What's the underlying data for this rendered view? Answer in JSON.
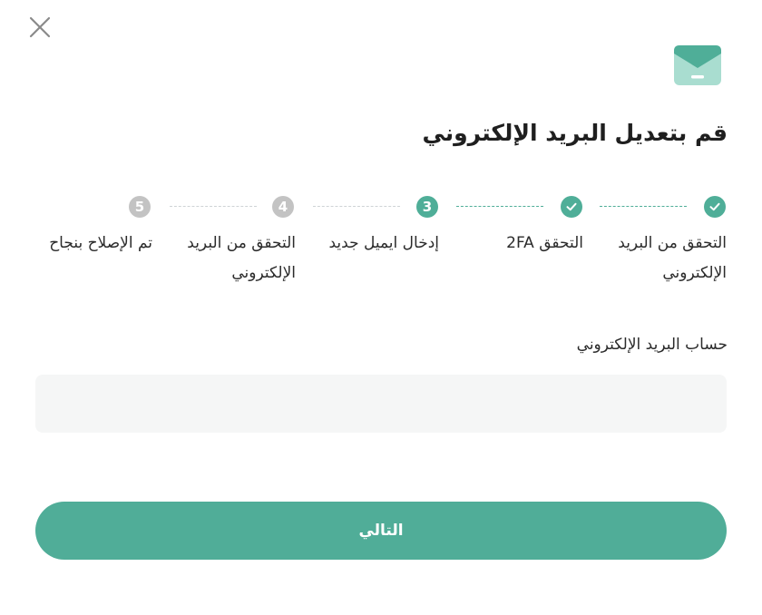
{
  "header": {
    "close_icon": "close-icon",
    "mail_icon": "envelope-icon",
    "title": "قم بتعديل البريد الإلكتروني"
  },
  "colors": {
    "accent": "#4fae98",
    "pending": "#c3c3c3",
    "input_bg": "#f5f6f6"
  },
  "stepper": {
    "current_step": 3,
    "steps": [
      {
        "label": "التحقق من البريد الإلكتروني",
        "status": "done",
        "icon": "check-icon"
      },
      {
        "label": "التحقق 2FA",
        "status": "done",
        "icon": "check-icon"
      },
      {
        "label": "إدخال ايميل جديد",
        "status": "current",
        "number": "3"
      },
      {
        "label": "التحقق من البريد الإلكتروني",
        "status": "pending",
        "number": "4"
      },
      {
        "label": "تم الإصلاح بنجاح",
        "status": "pending",
        "number": "5"
      }
    ]
  },
  "form": {
    "email_label": "حساب البريد الإلكتروني",
    "email_value": "",
    "email_placeholder": "",
    "next_label": "التالي"
  }
}
